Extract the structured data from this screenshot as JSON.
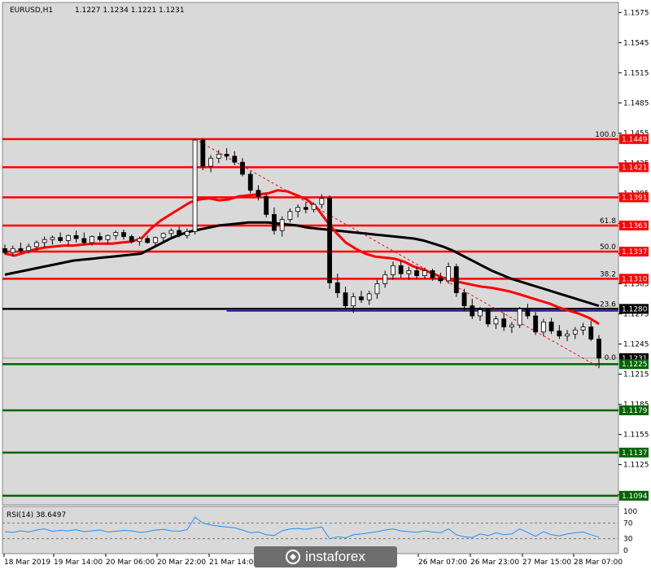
{
  "header": {
    "symbol": "EURUSD,H1",
    "ohlc": "1.1227 1.1234 1.1221 1.1231"
  },
  "colors": {
    "panel_bg": "#d9d9d9",
    "level_red": "#ff0000",
    "level_green": "#006400",
    "level_black": "#000000",
    "hline_blue": "#000080",
    "ma_fast": "#ff0000",
    "ma_slow": "#000000",
    "rsi_line": "#1e90ff",
    "candle_bull": "#ffffff",
    "candle_bear": "#000000",
    "price_tag_black": "#000000"
  },
  "chart_data": {
    "type": "candlestick",
    "title": "EURUSD,H1",
    "x_tick_labels": [
      "18 Mar 2019",
      "19 Mar 14:00",
      "20 Mar 06:00",
      "20 Mar 22:00",
      "21 Mar 14:00",
      "",
      "",
      "26 Mar 07:00",
      "26 Mar 23:00",
      "27 Mar 15:00",
      "28 Mar 07:00"
    ],
    "ylim": [
      1.1085,
      1.1585
    ],
    "y_ticks": [
      1.1575,
      1.1545,
      1.1515,
      1.1485,
      1.1455,
      1.1425,
      1.1395,
      1.1365,
      1.1335,
      1.1305,
      1.1275,
      1.1245,
      1.1215,
      1.1185,
      1.1155,
      1.1125,
      1.1095
    ],
    "price_levels": [
      {
        "price": 1.1449,
        "label": "1.1449",
        "color": "red"
      },
      {
        "price": 1.1421,
        "label": "1.1421",
        "color": "red"
      },
      {
        "price": 1.1391,
        "label": "1.1391",
        "color": "red"
      },
      {
        "price": 1.1363,
        "label": "1.1363",
        "color": "red"
      },
      {
        "price": 1.1337,
        "label": "1.1337",
        "color": "red"
      },
      {
        "price": 1.131,
        "label": "1.1310",
        "color": "red"
      },
      {
        "price": 1.128,
        "label": "1.1280",
        "color": "black"
      },
      {
        "price": 1.1231,
        "label": "1.1231",
        "color": "current"
      },
      {
        "price": 1.1225,
        "label": "1.1225",
        "color": "green"
      },
      {
        "price": 1.1179,
        "label": "1.1179",
        "color": "green"
      },
      {
        "price": 1.1137,
        "label": "1.1137",
        "color": "green"
      },
      {
        "price": 1.1094,
        "label": "1.1094",
        "color": "green"
      }
    ],
    "fibonacci": [
      {
        "label": "100.0",
        "price": 1.1449
      },
      {
        "label": "61.8",
        "price": 1.1363
      },
      {
        "label": "50.0",
        "price": 1.1337
      },
      {
        "label": "38.2",
        "price": 1.131
      },
      {
        "label": "23.6",
        "price": 1.128
      },
      {
        "label": "0.0",
        "price": 1.1227
      }
    ],
    "fib_line": {
      "start": [
        1.1449
      ],
      "end": [
        1.1222
      ]
    },
    "ma_fast": [
      1.1335,
      1.1333,
      1.1336,
      1.1339,
      1.1341,
      1.1342,
      1.1343,
      1.1343,
      1.1344,
      1.1345,
      1.1345,
      1.1345,
      1.1346,
      1.1347,
      1.135,
      1.136,
      1.1368,
      1.1374,
      1.138,
      1.1386,
      1.1389,
      1.139,
      1.1388,
      1.1389,
      1.1392,
      1.1393,
      1.1394,
      1.1395,
      1.1398,
      1.1397,
      1.1393,
      1.1389,
      1.1381,
      1.1368,
      1.1356,
      1.1346,
      1.134,
      1.1335,
      1.1332,
      1.1331,
      1.133,
      1.1327,
      1.1322,
      1.1319,
      1.1315,
      1.1311,
      1.1308,
      1.1306,
      1.1304,
      1.1302,
      1.1301,
      1.1299,
      1.1297,
      1.1294,
      1.1291,
      1.1288,
      1.1285,
      1.1281,
      1.1278,
      1.1275,
      1.1271,
      1.1265
    ],
    "ma_slow": [
      1.1314,
      1.1316,
      1.1318,
      1.132,
      1.1322,
      1.1324,
      1.1326,
      1.1328,
      1.1329,
      1.133,
      1.1331,
      1.1332,
      1.1333,
      1.1334,
      1.1335,
      1.134,
      1.1345,
      1.135,
      1.1354,
      1.1357,
      1.1359,
      1.1361,
      1.1363,
      1.1364,
      1.1365,
      1.1366,
      1.1366,
      1.1366,
      1.1365,
      1.1364,
      1.1363,
      1.1361,
      1.136,
      1.1359,
      1.1358,
      1.1357,
      1.1356,
      1.1355,
      1.1354,
      1.1353,
      1.1352,
      1.1351,
      1.135,
      1.1348,
      1.1345,
      1.1342,
      1.1338,
      1.1333,
      1.1328,
      1.1323,
      1.1318,
      1.1314,
      1.131,
      1.1307,
      1.1304,
      1.1301,
      1.1298,
      1.1295,
      1.1292,
      1.1289,
      1.1286,
      1.1283
    ],
    "candles": [
      [
        1.134,
        1.1344,
        1.1334,
        1.1336
      ],
      [
        1.1336,
        1.1343,
        1.1332,
        1.134
      ],
      [
        1.134,
        1.1346,
        1.1336,
        1.1338
      ],
      [
        1.1338,
        1.1345,
        1.1335,
        1.1342
      ],
      [
        1.1342,
        1.1348,
        1.1338,
        1.1346
      ],
      [
        1.1346,
        1.1352,
        1.1341,
        1.1349
      ],
      [
        1.1349,
        1.1353,
        1.1344,
        1.1351
      ],
      [
        1.1351,
        1.1356,
        1.1346,
        1.1348
      ],
      [
        1.1348,
        1.1354,
        1.1343,
        1.1353
      ],
      [
        1.1353,
        1.1358,
        1.1346,
        1.135
      ],
      [
        1.135,
        1.1356,
        1.1344,
        1.1346
      ],
      [
        1.1346,
        1.1353,
        1.1343,
        1.1352
      ],
      [
        1.1352,
        1.1356,
        1.1347,
        1.1349
      ],
      [
        1.1349,
        1.1354,
        1.1344,
        1.1353
      ],
      [
        1.1353,
        1.1358,
        1.1349,
        1.1356
      ],
      [
        1.1356,
        1.1359,
        1.1349,
        1.1352
      ],
      [
        1.1352,
        1.1354,
        1.1345,
        1.1347
      ],
      [
        1.1347,
        1.1352,
        1.1343,
        1.135
      ],
      [
        1.135,
        1.1353,
        1.1345,
        1.1346
      ],
      [
        1.1346,
        1.1352,
        1.1343,
        1.1351
      ],
      [
        1.1351,
        1.1356,
        1.1347,
        1.1355
      ],
      [
        1.1355,
        1.136,
        1.135,
        1.1358
      ],
      [
        1.1358,
        1.1362,
        1.1351,
        1.1353
      ],
      [
        1.1353,
        1.136,
        1.135,
        1.1357
      ],
      [
        1.1357,
        1.1449,
        1.1354,
        1.1448
      ],
      [
        1.1448,
        1.145,
        1.1418,
        1.1422
      ],
      [
        1.1422,
        1.1433,
        1.1416,
        1.143
      ],
      [
        1.143,
        1.1438,
        1.1425,
        1.1434
      ],
      [
        1.1434,
        1.144,
        1.1428,
        1.1432
      ],
      [
        1.1432,
        1.1437,
        1.1423,
        1.1426
      ],
      [
        1.1426,
        1.143,
        1.1412,
        1.1414
      ],
      [
        1.1414,
        1.1417,
        1.1395,
        1.1398
      ],
      [
        1.1398,
        1.1403,
        1.1388,
        1.1392
      ],
      [
        1.1392,
        1.1394,
        1.1371,
        1.1374
      ],
      [
        1.1374,
        1.1381,
        1.1354,
        1.1358
      ],
      [
        1.1358,
        1.1372,
        1.1352,
        1.1369
      ],
      [
        1.1369,
        1.138,
        1.1366,
        1.1377
      ],
      [
        1.1377,
        1.1384,
        1.1371,
        1.1381
      ],
      [
        1.1381,
        1.1386,
        1.1375,
        1.1379
      ],
      [
        1.1379,
        1.1386,
        1.1376,
        1.1384
      ],
      [
        1.1384,
        1.1394,
        1.138,
        1.139
      ],
      [
        1.139,
        1.1393,
        1.13,
        1.1306
      ],
      [
        1.1306,
        1.1315,
        1.1291,
        1.1296
      ],
      [
        1.1296,
        1.1302,
        1.1279,
        1.1283
      ],
      [
        1.1283,
        1.1296,
        1.1276,
        1.1292
      ],
      [
        1.1292,
        1.1298,
        1.1286,
        1.1289
      ],
      [
        1.1289,
        1.1298,
        1.1284,
        1.1295
      ],
      [
        1.1295,
        1.1309,
        1.129,
        1.1305
      ],
      [
        1.1305,
        1.1318,
        1.1301,
        1.1314
      ],
      [
        1.1314,
        1.1327,
        1.1309,
        1.1323
      ],
      [
        1.1323,
        1.1328,
        1.1311,
        1.1315
      ],
      [
        1.1315,
        1.1322,
        1.1309,
        1.1318
      ],
      [
        1.1318,
        1.1322,
        1.131,
        1.1313
      ],
      [
        1.1313,
        1.1321,
        1.131,
        1.1318
      ],
      [
        1.1318,
        1.132,
        1.1308,
        1.1311
      ],
      [
        1.1311,
        1.1316,
        1.1305,
        1.1308
      ],
      [
        1.1308,
        1.1326,
        1.1305,
        1.1322
      ],
      [
        1.1322,
        1.1325,
        1.1292,
        1.1296
      ],
      [
        1.1296,
        1.13,
        1.1278,
        1.1283
      ],
      [
        1.1283,
        1.129,
        1.127,
        1.1273
      ],
      [
        1.1273,
        1.1282,
        1.1268,
        1.1279
      ],
      [
        1.1279,
        1.1281,
        1.1262,
        1.1265
      ],
      [
        1.1265,
        1.1273,
        1.126,
        1.127
      ],
      [
        1.127,
        1.1276,
        1.1258,
        1.1262
      ],
      [
        1.1262,
        1.1267,
        1.1256,
        1.1264
      ],
      [
        1.1264,
        1.1282,
        1.1261,
        1.128
      ],
      [
        1.128,
        1.1285,
        1.127,
        1.1273
      ],
      [
        1.1273,
        1.1277,
        1.1254,
        1.1257
      ],
      [
        1.1257,
        1.127,
        1.1253,
        1.1267
      ],
      [
        1.1267,
        1.1271,
        1.1255,
        1.1258
      ],
      [
        1.1258,
        1.1264,
        1.125,
        1.1253
      ],
      [
        1.1253,
        1.1259,
        1.1248,
        1.1255
      ],
      [
        1.1255,
        1.1262,
        1.125,
        1.1259
      ],
      [
        1.1259,
        1.1266,
        1.1254,
        1.1262
      ],
      [
        1.1262,
        1.1268,
        1.1248,
        1.125
      ],
      [
        1.125,
        1.1254,
        1.1221,
        1.1231
      ]
    ],
    "rsi": {
      "label": "RSI(14) 38.6497",
      "period": 14,
      "value": 38.6497,
      "ylim": [
        0,
        100
      ],
      "ticks": [
        100,
        70,
        30,
        0
      ],
      "levels": [
        70,
        30
      ],
      "values": [
        48,
        46,
        50,
        47,
        52,
        55,
        49,
        51,
        50,
        53,
        48,
        50,
        52,
        47,
        49,
        51,
        50,
        46,
        48,
        52,
        54,
        50,
        49,
        53,
        85,
        70,
        65,
        62,
        60,
        58,
        52,
        45,
        47,
        40,
        38,
        50,
        55,
        56,
        54,
        57,
        60,
        30,
        35,
        32,
        40,
        42,
        45,
        48,
        52,
        55,
        50,
        48,
        46,
        50,
        47,
        45,
        55,
        40,
        35,
        33,
        42,
        38,
        45,
        40,
        42,
        55,
        46,
        36,
        48,
        40,
        37,
        42,
        45,
        47,
        40,
        34
      ]
    }
  },
  "watermark": {
    "text": "instaforex"
  }
}
